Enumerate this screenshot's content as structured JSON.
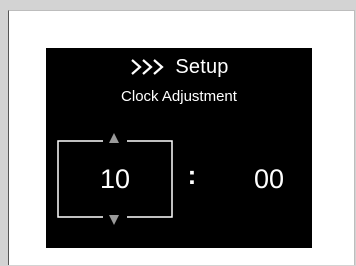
{
  "header": {
    "icon": "triple-chevron-right-icon",
    "title": "Setup"
  },
  "subtitle": "Clock Adjustment",
  "time": {
    "hour": "10",
    "separator": ":",
    "minute": "00"
  },
  "colors": {
    "screen_background": "#000000",
    "text": "#ffffff",
    "selector_frame": "#ffffff",
    "arrow": "#9a9a9a",
    "page_background": "#d3d3d3"
  }
}
